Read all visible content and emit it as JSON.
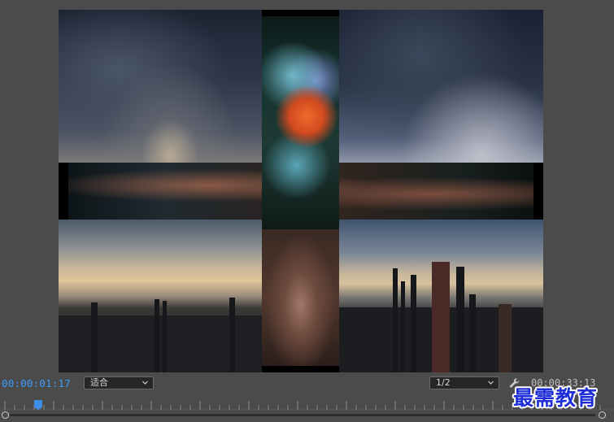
{
  "monitor": {
    "current_timecode": "00:00:01:17",
    "fit_dropdown": {
      "selected": "适合"
    },
    "resolution_dropdown": {
      "selected": "1/2"
    },
    "total_duration": "00:00:33:13"
  },
  "watermark": {
    "text": "最需教育"
  },
  "icons": {
    "settings": "wrench-icon",
    "dropdown_arrow": "chevron-down-icon"
  },
  "colors": {
    "timecode": "#3d9dff",
    "playhead": "#3d8fe6",
    "panel_background": "#4b4b4b",
    "watermark": "#1e2fd8"
  }
}
